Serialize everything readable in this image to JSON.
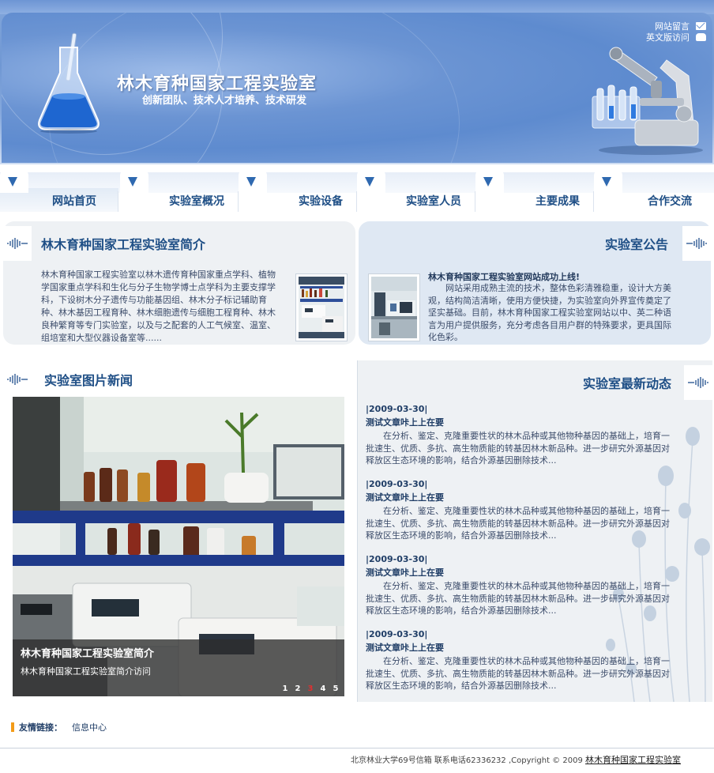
{
  "header": {
    "title": "林木育种国家工程实验室",
    "subtitle": "创新团队、技术人才培养、技术研发",
    "links": [
      {
        "label": "网站留言",
        "icon": "mail-icon"
      },
      {
        "label": "英文版访问",
        "icon": "phone-icon"
      }
    ]
  },
  "nav": {
    "items": [
      {
        "label": "网站首页",
        "active": true
      },
      {
        "label": "实验室概况"
      },
      {
        "label": "实验设备"
      },
      {
        "label": "实验室人员"
      },
      {
        "label": "主要成果"
      },
      {
        "label": "合作交流"
      }
    ]
  },
  "intro": {
    "title": "林木育种国家工程实验室简介",
    "text": "林木育种国家工程实验室以林木遗传育种国家重点学科、植物学国家重点学科和生化与分子生物学博士点学科为主要支撑学科，下设树木分子遗传与功能基因组、林木分子标记辅助育种、林木基因工程育种、林木细胞遗传与细胞工程育种、林木良种繁育等专门实验室，以及与之配套的人工气候室、温室、组培室和大型仪器设备室等......"
  },
  "notice": {
    "title": "实验室公告",
    "headline": "林木育种国家工程实验室网站成功上线!",
    "text": "网站采用成熟主流的技术，整体色彩清雅稳重，设计大方美观，结构简洁清晰，使用方便快捷，为实验室向外界宣传奠定了坚实基础。目前，林木育种国家工程实验室网站以中、英二种语言为用户提供服务，充分考虑各目用户群的特殊要求，更具国际化色彩。"
  },
  "photo_news": {
    "title": "实验室图片新闻",
    "caption_title": "林木育种国家工程实验室简介",
    "caption_sub": "林木育种国家工程实验室简介访问",
    "pages": [
      "1",
      "2",
      "3",
      "4",
      "5"
    ],
    "current_page": "3"
  },
  "dynamics": {
    "title": "实验室最新动态",
    "items": [
      {
        "date": "|2009-03-30|",
        "title": "测试文章咔上上在要",
        "body": "在分析、鉴定、克隆重要性状的林木品种或其他物种基因的基础上，培育一批速生、优质、多抗、高生物质能的转基因林木新品种。进一步研究外源基因对释放区生态环境的影响，结合外源基因删除技术..."
      },
      {
        "date": "|2009-03-30|",
        "title": "测试文章咔上上在要",
        "body": "在分析、鉴定、克隆重要性状的林木品种或其他物种基因的基础上，培育一批速生、优质、多抗、高生物质能的转基因林木新品种。进一步研究外源基因对释放区生态环境的影响，结合外源基因删除技术..."
      },
      {
        "date": "|2009-03-30|",
        "title": "测试文章咔上上在要",
        "body": "在分析、鉴定、克隆重要性状的林木品种或其他物种基因的基础上，培育一批速生、优质、多抗、高生物质能的转基因林木新品种。进一步研究外源基因对释放区生态环境的影响，结合外源基因删除技术..."
      },
      {
        "date": "|2009-03-30|",
        "title": "测试文章咔上上在要",
        "body": "在分析、鉴定、克隆重要性状的林木品种或其他物种基因的基础上，培育一批速生、优质、多抗、高生物质能的转基因林木新品种。进一步研究外源基因对释放区生态环境的影响，结合外源基因删除技术..."
      }
    ]
  },
  "friend_links": {
    "label": "友情链接：",
    "items": [
      "信息中心"
    ]
  },
  "footer": {
    "text": "北京林业大学69号信箱  联系电话62336232 ,Copyright © 2009 ",
    "link": "林木育种国家工程实验室"
  },
  "colors": {
    "brand_blue": "#1f4f86",
    "header_blue": "#6f97d3",
    "accent_orange": "#f39b18"
  }
}
